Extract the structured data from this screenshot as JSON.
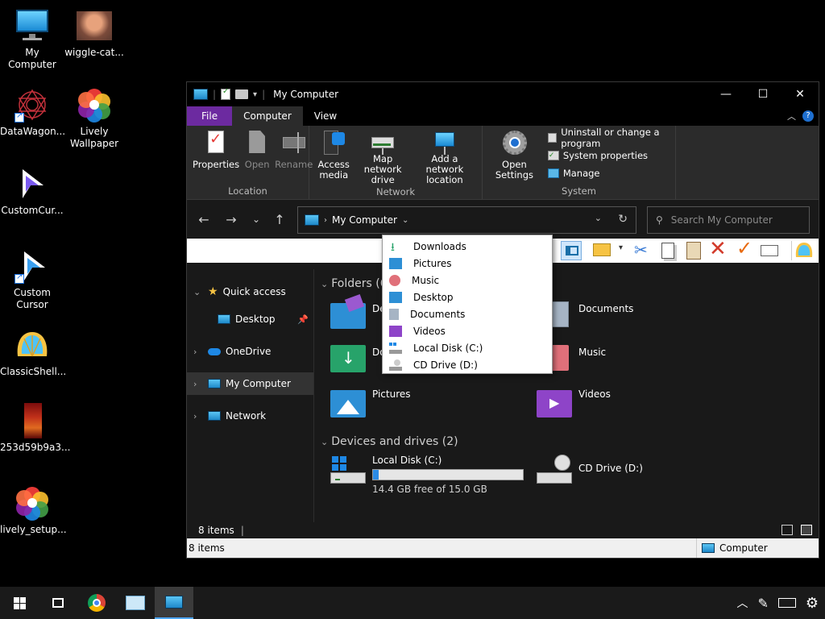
{
  "desktop": {
    "icons": [
      {
        "label": "My Computer"
      },
      {
        "label": "wiggle-cat..."
      },
      {
        "label": "DataWagon..."
      },
      {
        "label": "Lively Wallpaper"
      },
      {
        "label": "CustomCur..."
      },
      {
        "label": "Custom Cursor"
      },
      {
        "label": "ClassicShell..."
      },
      {
        "label": "253d59b9a3..."
      },
      {
        "label": "lively_setup..."
      }
    ]
  },
  "window": {
    "title": "My Computer",
    "tabs": [
      {
        "label": "File"
      },
      {
        "label": "Computer"
      },
      {
        "label": "View"
      }
    ],
    "ribbon": {
      "location": {
        "label": "Location",
        "properties": "Properties",
        "open": "Open",
        "rename": "Rename"
      },
      "network": {
        "label": "Network",
        "access_media": "Access media",
        "map_drive": "Map network drive",
        "add_location": "Add a network location"
      },
      "system": {
        "label": "System",
        "open_settings": "Open Settings",
        "uninstall": "Uninstall or change a program",
        "sys_props": "System properties",
        "manage": "Manage"
      }
    },
    "address": {
      "path": "My Computer"
    },
    "search": {
      "placeholder": "Search My Computer"
    },
    "nav": {
      "items": [
        {
          "label": "Quick access"
        },
        {
          "label": "Desktop"
        },
        {
          "label": "OneDrive"
        },
        {
          "label": "My Computer"
        },
        {
          "label": "Network"
        }
      ]
    },
    "content": {
      "folders_header": "Folders (6)",
      "folders": [
        {
          "label": "Desktop"
        },
        {
          "label": "Documents"
        },
        {
          "label": "Downloads"
        },
        {
          "label": "Music"
        },
        {
          "label": "Pictures"
        },
        {
          "label": "Videos"
        }
      ],
      "drives_header": "Devices and drives (2)",
      "drives": [
        {
          "label": "Local Disk (C:)",
          "free": "14.4 GB free of 15.0 GB",
          "used_fraction": 0.04
        },
        {
          "label": "CD Drive (D:)"
        }
      ]
    },
    "status_inner": "8 items",
    "statusbar": {
      "left": "8 items",
      "right": "Computer"
    }
  },
  "dropdown": {
    "items": [
      {
        "label": "Downloads"
      },
      {
        "label": "Pictures"
      },
      {
        "label": "Music"
      },
      {
        "label": "Desktop"
      },
      {
        "label": "Documents"
      },
      {
        "label": "Videos"
      },
      {
        "label": "Local Disk (C:)"
      },
      {
        "label": "CD Drive (D:)"
      }
    ]
  },
  "colors": {
    "file_tab": "#6c2aa0",
    "accent": "#1e88c9",
    "progress": "#2b8be6"
  }
}
